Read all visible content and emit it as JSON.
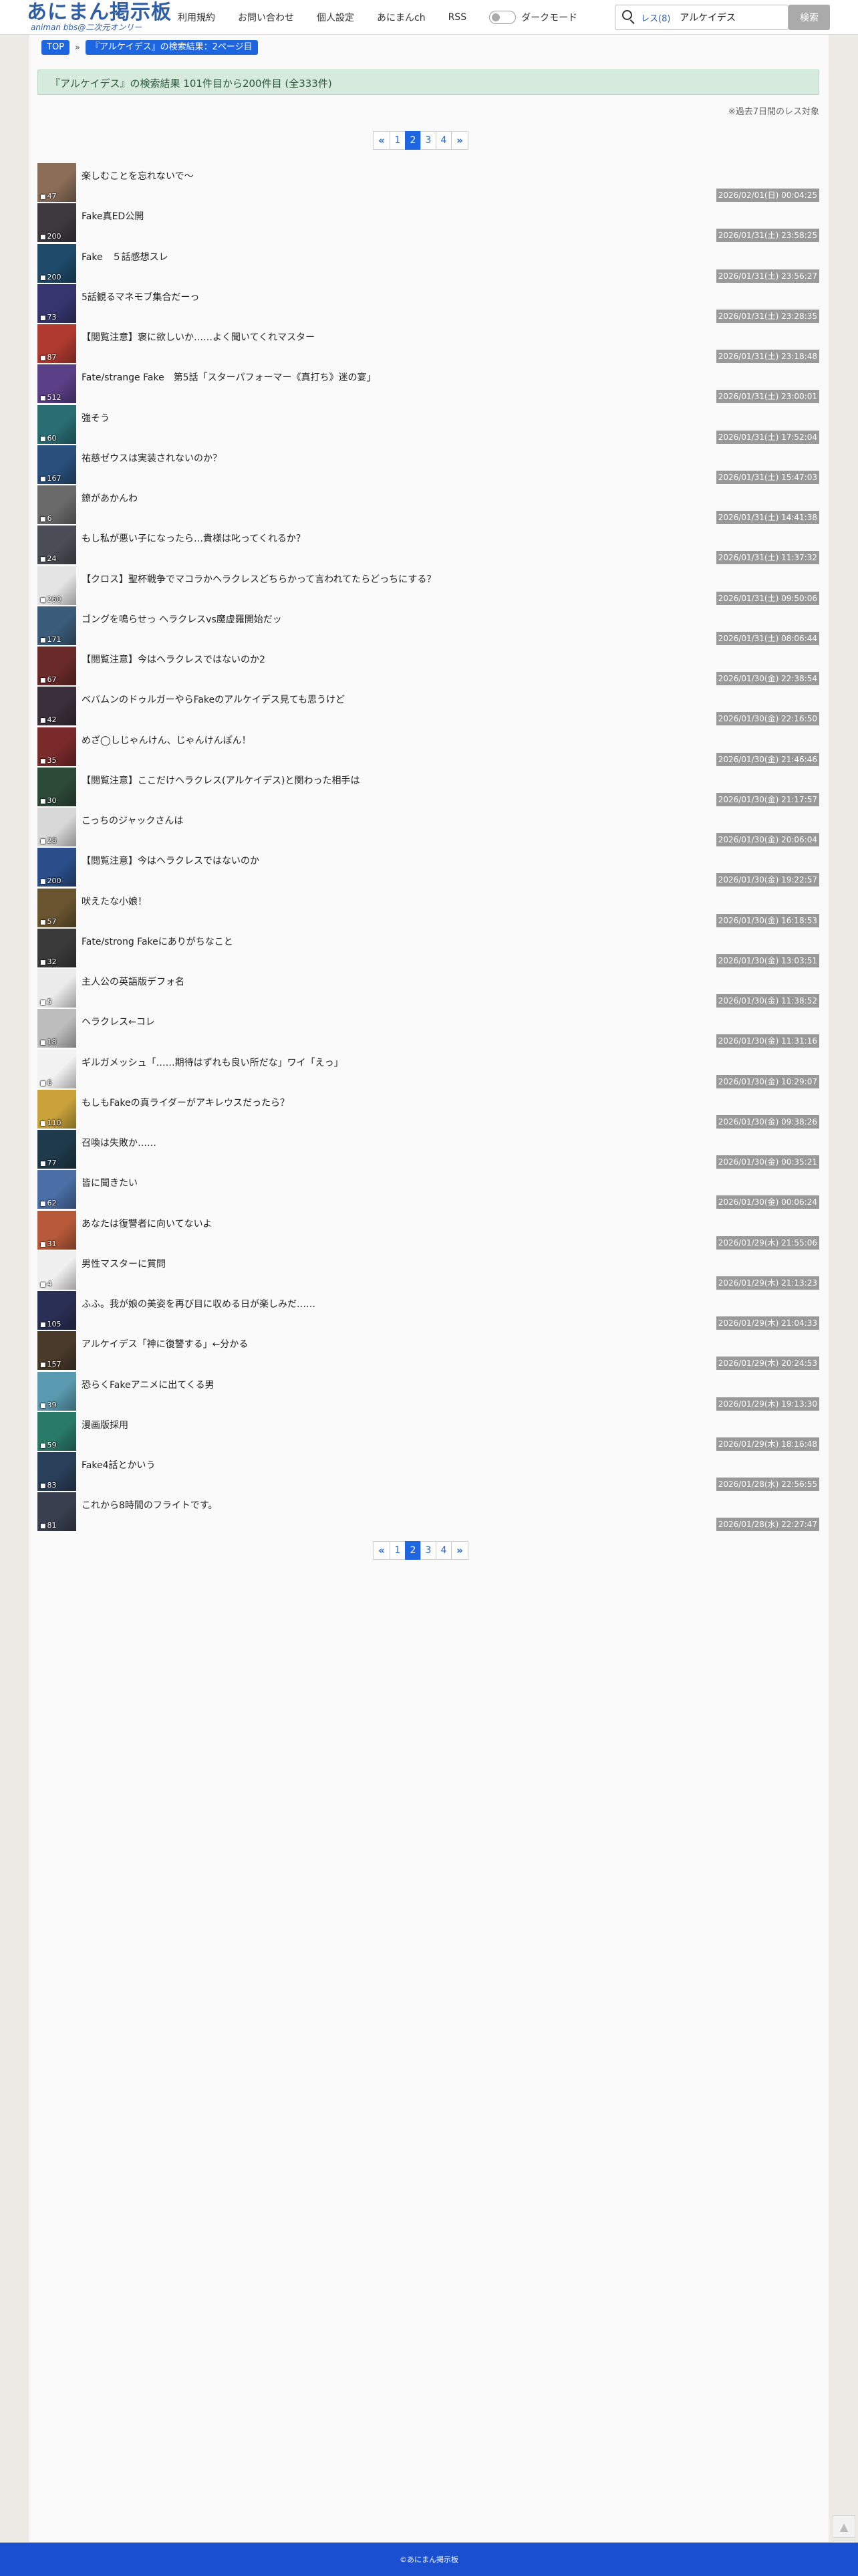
{
  "header": {
    "logo_main": "あにまん掲示板",
    "logo_sub": "animan bbs@二次元オンリー",
    "nav": [
      "利用規約",
      "お問い合わせ",
      "個人設定",
      "あにまんch",
      "RSS"
    ],
    "dark_mode_label": "ダークモード",
    "search_scope": "レス(8)",
    "search_value": "アルケイデス",
    "search_button": "検索"
  },
  "breadcrumb": {
    "top": "TOP",
    "separator": "»",
    "current": "『アルケイデス』の検索結果：2ページ目"
  },
  "result_summary": "『アルケイデス』の検索結果 101件目から200件目 (全333件)",
  "note": "※過去7日間のレス対象",
  "pagination": {
    "prev_icon": "«",
    "next_icon": "»",
    "pages": [
      "1",
      "2",
      "3",
      "4"
    ],
    "current": "2"
  },
  "threads": [
    {
      "title": "楽しむことを忘れないで〜",
      "count": "47",
      "date": "2026/02/01(日) 00:04:25",
      "color": "#8a6e58"
    },
    {
      "title": "Fake真ED公開",
      "count": "200",
      "date": "2026/01/31(土) 23:58:25",
      "color": "#3d3a3f"
    },
    {
      "title": "Fake　５話感想スレ",
      "count": "200",
      "date": "2026/01/31(土) 23:56:27",
      "color": "#1f4a6a"
    },
    {
      "title": "5話観るマネモブ集合だーっ",
      "count": "73",
      "date": "2026/01/31(土) 23:28:35",
      "color": "#35366e"
    },
    {
      "title": "【閲覧注意】褒に欲しいか……よく聞いてくれマスター",
      "count": "87",
      "date": "2026/01/31(土) 23:18:48",
      "color": "#b03a30"
    },
    {
      "title": "Fate/strange Fake　第5話「スターパフォーマー《真打ち》迷の宴」",
      "count": "512",
      "date": "2026/01/31(土) 23:00:01",
      "color": "#5b3f87"
    },
    {
      "title": "強そう",
      "count": "60",
      "date": "2026/01/31(土) 17:52:04",
      "color": "#2a6e74"
    },
    {
      "title": "祐慈ゼウスは実装されないのか？",
      "count": "167",
      "date": "2026/01/31(土) 15:47:03",
      "color": "#294f7c"
    },
    {
      "title": "鐐があかんわ",
      "count": "6",
      "date": "2026/01/31(土) 14:41:38",
      "color": "#6a6a6a"
    },
    {
      "title": "もし私が悪い子になったら…貴様は叱ってくれるか？",
      "count": "24",
      "date": "2026/01/31(土) 11:37:32",
      "color": "#4a4d55"
    },
    {
      "title": "【クロス】聖杯戦争でマコラかヘラクレスどちらかって言われてたらどっちにする？",
      "count": "260",
      "date": "2026/01/31(土) 09:50:06",
      "color": "#e5e5e5"
    },
    {
      "title": "ゴングを鳴らせっ ヘラクレスvs魔虚羅開始だッ",
      "count": "171",
      "date": "2026/01/31(土) 08:06:44",
      "color": "#3b5c7a"
    },
    {
      "title": "【閲覧注意】今はヘラクレスではないのか2",
      "count": "67",
      "date": "2026/01/30(金) 22:38:54",
      "color": "#6b2a2a"
    },
    {
      "title": "ベバムンのドゥルガーやらFakeのアルケイデス見ても思うけど",
      "count": "42",
      "date": "2026/01/30(金) 22:16:50",
      "color": "#3a2f3a"
    },
    {
      "title": "めざ◯しじゃんけん、じゃんけんぽん！",
      "count": "35",
      "date": "2026/01/30(金) 21:46:46",
      "color": "#7a2a2a"
    },
    {
      "title": "【閲覧注意】ここだけヘラクレス(アルケイデス)と関わった相手は",
      "count": "30",
      "date": "2026/01/30(金) 21:17:57",
      "color": "#2d4a38"
    },
    {
      "title": "こっちのジャックさんは",
      "count": "28",
      "date": "2026/01/30(金) 20:06:04",
      "color": "#d8d8d8"
    },
    {
      "title": "【閲覧注意】今はヘラクレスではないのか",
      "count": "200",
      "date": "2026/01/30(金) 19:22:57",
      "color": "#2a4f8a"
    },
    {
      "title": "吠えたな小娘！",
      "count": "57",
      "date": "2026/01/30(金) 16:18:53",
      "color": "#6a5530"
    },
    {
      "title": "Fate/strong Fakeにありがちなこと",
      "count": "32",
      "date": "2026/01/30(金) 13:03:51",
      "color": "#3a3a3a"
    },
    {
      "title": "主人公の英語版デフォ名",
      "count": "5",
      "date": "2026/01/30(金) 11:38:52",
      "color": "#ececec"
    },
    {
      "title": "ヘラクレス←コレ",
      "count": "18",
      "date": "2026/01/30(金) 11:31:16",
      "color": "#bdbdbd"
    },
    {
      "title": "ギルガメッシュ「……期待はずれも良い所だな」ワイ「えっ」",
      "count": "6",
      "date": "2026/01/30(金) 10:29:07",
      "color": "#f2f2f2"
    },
    {
      "title": "もしもFakeの真ライダーがアキレウスだったら？",
      "count": "110",
      "date": "2026/01/30(金) 09:38:26",
      "color": "#c9a23a"
    },
    {
      "title": "召喚は失敗か……",
      "count": "77",
      "date": "2026/01/30(金) 00:35:21",
      "color": "#1f3a4a"
    },
    {
      "title": "皆に聞きたい",
      "count": "62",
      "date": "2026/01/30(金) 00:06:24",
      "color": "#4a6ea5"
    },
    {
      "title": "あなたは復讐者に向いてないよ",
      "count": "31",
      "date": "2026/01/29(木) 21:55:06",
      "color": "#b85a3a"
    },
    {
      "title": "男性マスターに質問",
      "count": "4",
      "date": "2026/01/29(木) 21:13:23",
      "color": "#f0f0f0"
    },
    {
      "title": "ふふ。我が娘の美姿を再び目に収める日が楽しみだ……",
      "count": "105",
      "date": "2026/01/29(木) 21:04:33",
      "color": "#2a2f55"
    },
    {
      "title": "アルケイデス「神に復讐する」←分かる",
      "count": "157",
      "date": "2026/01/29(木) 20:24:53",
      "color": "#4a3a2a"
    },
    {
      "title": "恐らくFakeアニメに出てくる男",
      "count": "39",
      "date": "2026/01/29(木) 19:13:30",
      "color": "#5a9ab0"
    },
    {
      "title": "漫画版採用",
      "count": "59",
      "date": "2026/01/29(木) 18:16:48",
      "color": "#2a7a6a"
    },
    {
      "title": "Fake4話とかいう",
      "count": "83",
      "date": "2026/01/28(水) 22:56:55",
      "color": "#2a3f5a"
    },
    {
      "title": "これから8時間のフライトです。",
      "count": "81",
      "date": "2026/01/28(水) 22:27:47",
      "color": "#3a4050"
    }
  ],
  "footer": "©あにまん掲示板"
}
